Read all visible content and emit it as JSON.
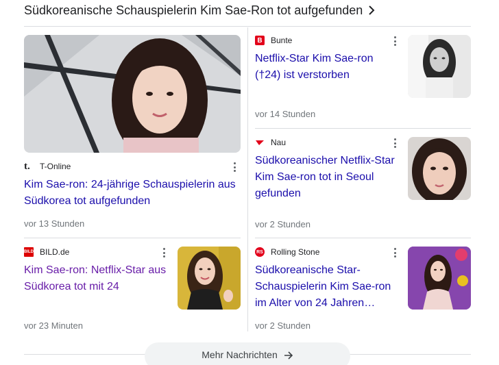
{
  "header": {
    "title": "Südkoreanische Schauspielerin Kim Sae-Ron tot aufgefunden"
  },
  "cards": [
    {
      "source": "T-Online",
      "logo_text": "t.",
      "logo_color": "#ffffff",
      "logo_text_color": "#e10000",
      "headline": "Kim Sae-ron: 24-jährige Schauspielerin aus Südkorea tot aufgefunden",
      "time": "vor 13 Stunden",
      "visited": false
    },
    {
      "source": "Bunte",
      "logo_text": "B",
      "logo_color": "#e2001a",
      "headline": "Netflix-Star Kim Sae-ron (†24) ist verstorben",
      "time": "vor 14 Stunden",
      "visited": false
    },
    {
      "source": "Nau",
      "logo_text": "",
      "logo_color": "#e2001a",
      "headline": "Südkoreanischer Netflix-Star Kim Sae-ron tot in Seoul gefunden",
      "time": "vor 2 Stunden",
      "visited": false
    },
    {
      "source": "BILD.de",
      "logo_text": "BILD",
      "logo_color": "#dd0000",
      "headline": "Kim Sae-ron: Netflix-Star aus Südkorea tot mit 24",
      "time": "vor 23 Minuten",
      "visited": true
    },
    {
      "source": "Rolling Stone",
      "logo_text": "RS",
      "logo_color": "#e2001a",
      "headline": "Südkoreanische Star-Schauspielerin Kim Sae-ron im Alter von 24 Jahren…",
      "time": "vor 2 Stunden",
      "visited": false
    }
  ],
  "footer": {
    "more_label": "Mehr Nachrichten"
  },
  "icons": {
    "more_options": "more-vert-icon",
    "chevron": "chevron-right-icon",
    "arrow": "arrow-right-icon"
  }
}
